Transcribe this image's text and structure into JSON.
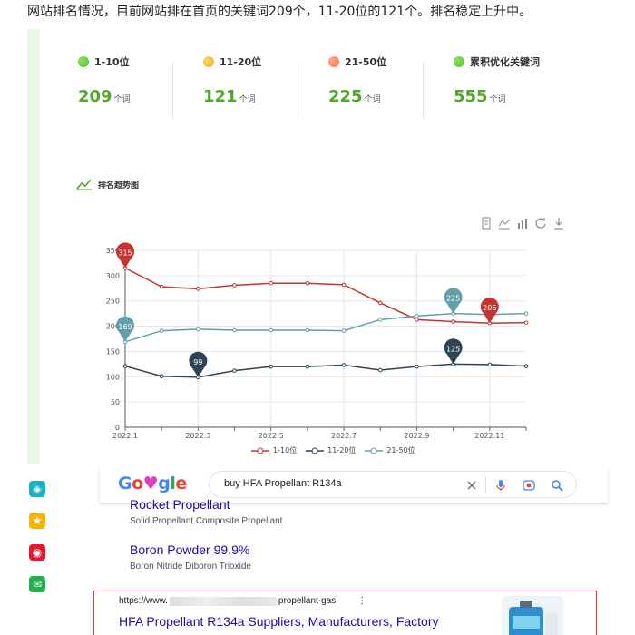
{
  "intro_text": "网站排名情况，目前网站排在首页的关键词209个，11-20位的121个。排名稳定上升中。",
  "stats": [
    {
      "label": "1-10位",
      "value": "209",
      "unit": "个词",
      "color": "#52c41a"
    },
    {
      "label": "11-20位",
      "value": "121",
      "unit": "个词",
      "color": "#faad14"
    },
    {
      "label": "21-50位",
      "value": "225",
      "unit": "个词",
      "color": "#ff7a45"
    },
    {
      "label": "累积优化关键词",
      "value": "555",
      "unit": "个词",
      "color": "#52c41a"
    }
  ],
  "trend_title": "排名趋势图",
  "toolbox_icons": [
    "data-view-icon",
    "line-chart-icon",
    "bar-chart-icon",
    "restore-icon",
    "download-icon"
  ],
  "chart_data": {
    "type": "line",
    "x": [
      "2022.1",
      "2022.2",
      "2022.3",
      "2022.4",
      "2022.5",
      "2022.6",
      "2022.7",
      "2022.8",
      "2022.9",
      "2022.10",
      "2022.11",
      "2022.12"
    ],
    "x_tick_labels": [
      "2022.1",
      "2022.3",
      "2022.5",
      "2022.7",
      "2022.9",
      "2022.11"
    ],
    "ylim": [
      0,
      350
    ],
    "y_ticks": [
      0,
      50,
      100,
      150,
      200,
      250,
      300,
      350
    ],
    "grid": true,
    "legend_position": "bottom",
    "series": [
      {
        "name": "1-10位",
        "color": "#c23531",
        "values": [
          315,
          278,
          274,
          281,
          285,
          285,
          282,
          246,
          213,
          209,
          206,
          207
        ],
        "markers": [
          {
            "type": "max",
            "label": "315"
          },
          {
            "type": "min",
            "label": "206"
          }
        ]
      },
      {
        "name": "11-20位",
        "color": "#2f4554",
        "values": [
          121,
          101,
          99,
          112,
          120,
          120,
          123,
          113,
          120,
          125,
          124,
          121
        ],
        "markers": [
          {
            "type": "min",
            "label": "99"
          },
          {
            "type": "max",
            "label": "125"
          }
        ]
      },
      {
        "name": "21-50位",
        "color": "#61a0a8",
        "values": [
          169,
          191,
          194,
          192,
          192,
          192,
          191,
          213,
          220,
          225,
          223,
          225
        ],
        "markers": [
          {
            "type": "min",
            "label": "169"
          },
          {
            "type": "max",
            "label": "225"
          }
        ]
      }
    ]
  },
  "sidebar_icons": [
    {
      "name": "qq-icon",
      "color": "#18b4c4",
      "glyph": "◈"
    },
    {
      "name": "star-icon",
      "color": "#f5b40b",
      "glyph": "★"
    },
    {
      "name": "weibo-icon",
      "color": "#e6162d",
      "glyph": "◉"
    },
    {
      "name": "mail-icon",
      "color": "#22b14c",
      "glyph": "✉"
    }
  ],
  "google": {
    "query": "buy HFA Propellant R134a",
    "results": [
      {
        "title": "Rocket Propellant",
        "desc": "Solid Propellant Composite Propellant"
      },
      {
        "title": "Boron Powder 99.9%",
        "desc": "Boron Nitride Diboron Trioxide"
      }
    ],
    "highlight": {
      "url_prefix": "https://www.",
      "url_suffix": "propellant-gas",
      "title": "HFA Propellant R134a Suppliers, Manufacturers, Factory"
    }
  }
}
